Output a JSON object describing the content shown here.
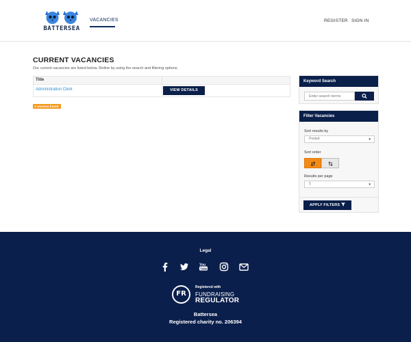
{
  "header": {
    "logo_text": "BATTERSEA",
    "nav": {
      "vacancies": "VACANCIES",
      "register": "REGISTER",
      "sign_in": "SIGN IN"
    }
  },
  "main": {
    "title": "CURRENT VACANCIES",
    "intro": "Our current vacancies are listed below. Refine by using the search and filtering options.",
    "table": {
      "columns": [
        "Title",
        ""
      ],
      "rows": [
        {
          "title": "Administration Clerk",
          "action_label": "VIEW DETAILS"
        }
      ]
    },
    "found_badge": "1 vacancy found."
  },
  "sidebar": {
    "keyword_search": {
      "heading": "Keyword Search",
      "placeholder": "Enter search terms",
      "button_icon": "search-icon"
    },
    "filter": {
      "heading": "Filter Vacancies",
      "sort_by_label": "Sort results by",
      "sort_by_value": "Posted",
      "sort_order_label": "Sort order",
      "sort_order_active": "descending",
      "results_per_page_label": "Results per page",
      "results_per_page_value": "5",
      "apply_label": "APPLY FILTERS"
    }
  },
  "footer": {
    "legal": "Legal",
    "social_icons": [
      "facebook-icon",
      "twitter-icon",
      "youtube-icon",
      "instagram-icon",
      "email-icon"
    ],
    "regulator": {
      "mark": "FR",
      "line1": "Registered with",
      "line2": "FUNDRAISING",
      "line3": "REGULATOR"
    },
    "org_name": "Battersea",
    "charity_no": "Registered charity no. 206394"
  },
  "colors": {
    "navy": "#0a1f4a",
    "footer_bg": "#0b1f4c",
    "accent_orange": "#f28a16",
    "link_blue": "#2a8fd0"
  }
}
